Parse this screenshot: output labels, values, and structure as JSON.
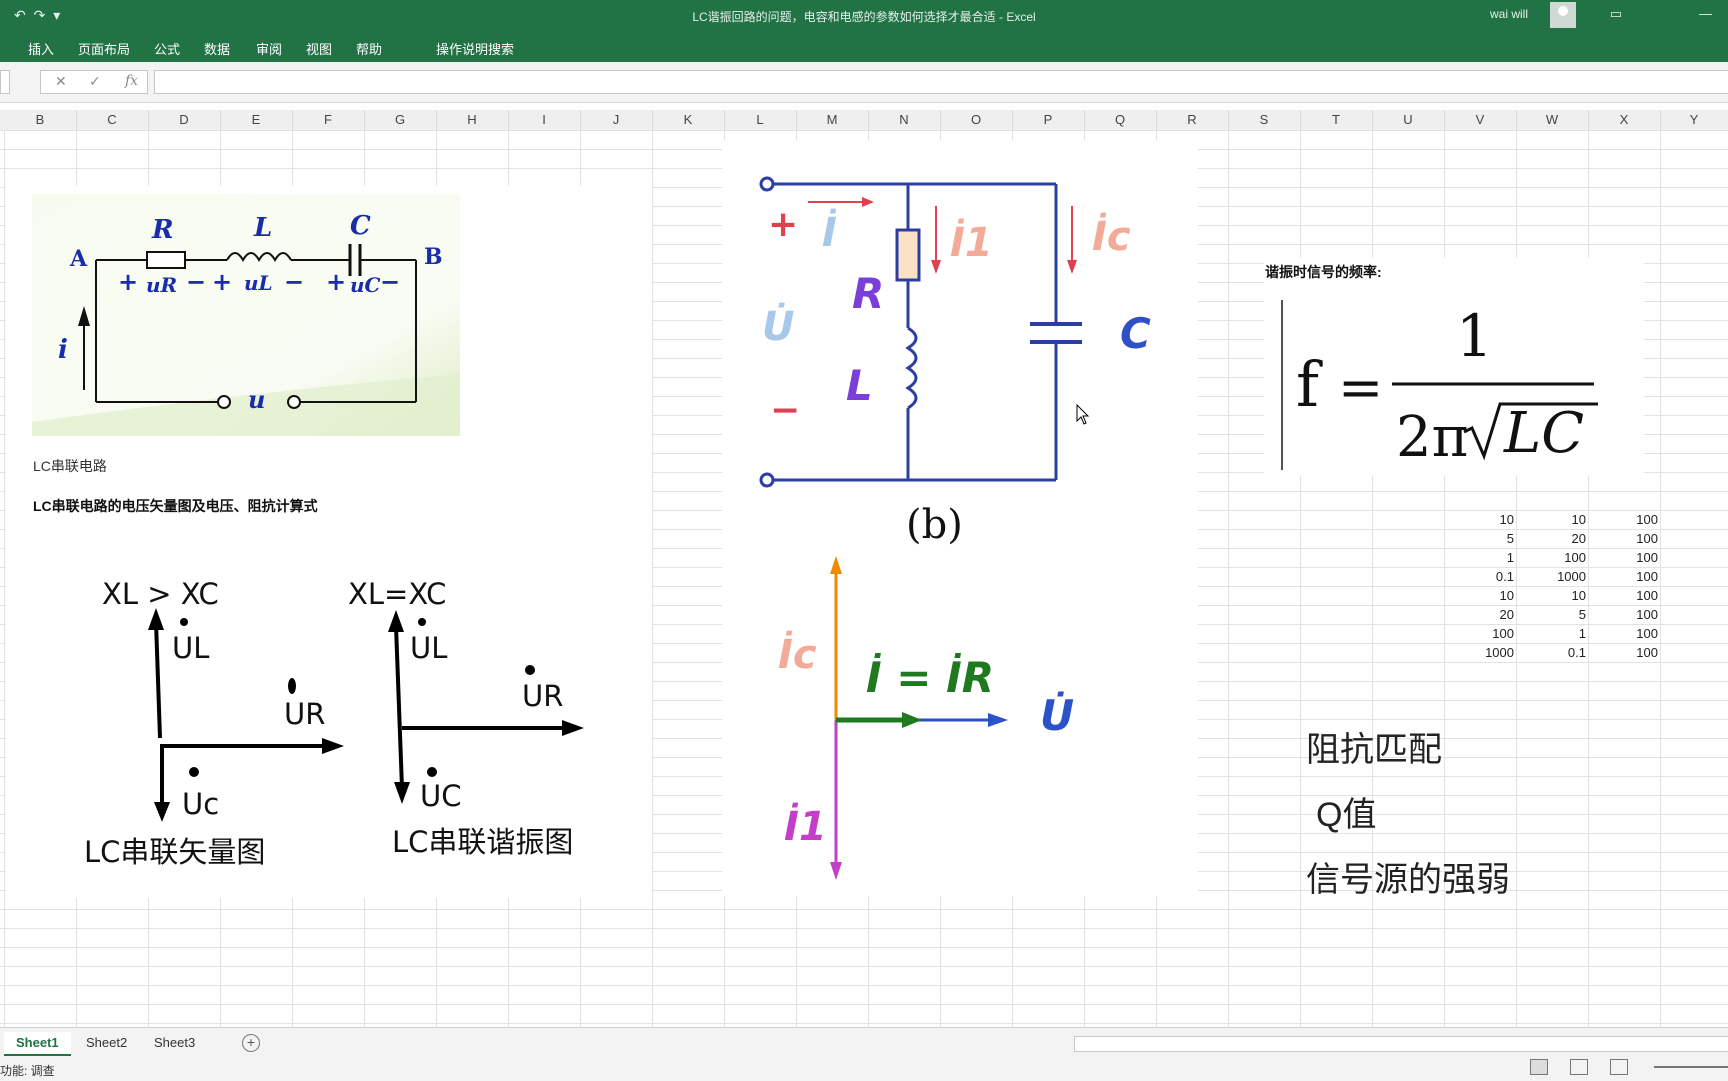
{
  "window": {
    "title": "LC谐振回路的问题，电容和电感的参数如何选择才最合适  -  Excel",
    "user": "wai will",
    "qat": "↶ ↷ ▾"
  },
  "ribbon": {
    "tabs": [
      "插入",
      "页面布局",
      "公式",
      "数据",
      "审阅",
      "视图",
      "帮助"
    ],
    "search": "操作说明搜索"
  },
  "formula_bar": {
    "cancel_icon": "✕",
    "enter_icon": "✓",
    "fx_label": "fx",
    "value": ""
  },
  "columns": [
    "B",
    "C",
    "D",
    "E",
    "F",
    "G",
    "H",
    "I",
    "J",
    "K",
    "L",
    "M",
    "N",
    "O",
    "P",
    "Q",
    "R",
    "S",
    "T",
    "U",
    "V",
    "W",
    "X",
    "Y"
  ],
  "series_circuit": {
    "labels": {
      "R": "R",
      "L": "L",
      "C": "C",
      "A": "A",
      "B": "B",
      "i": "i",
      "u": "u",
      "uR": "uR",
      "uL": "uL",
      "uC": "uC"
    },
    "caption": "LC串联电路"
  },
  "heading_vector": "LC串联电路的电压矢量图及电压、阻抗计算式",
  "vector_left": {
    "condition": "XL > XC",
    "UL": "UL",
    "UR": "UR",
    "UC": "Uc",
    "caption": "LC串联矢量图"
  },
  "vector_right": {
    "condition": "XL=XC",
    "UL": "UL",
    "UR": "UR",
    "UC": "UC",
    "caption": "LC串联谐振图"
  },
  "parallel_circuit": {
    "plus": "+",
    "minus": "−",
    "I": "İ",
    "U": "U̇",
    "I1": "İ1",
    "Ic": "İc",
    "R": "R",
    "L": "L",
    "C": "C",
    "caption": "(b)"
  },
  "phasor_parallel": {
    "Ic": "İc",
    "I_eq_IR": "İ = İR",
    "U": "U̇",
    "I1": "İ1"
  },
  "frequency": {
    "heading": "谐振时信号的频率:",
    "lhs": "f",
    "eq": "=",
    "numerator": "1",
    "denominator_prefix": "2π",
    "denominator_radicand": "LC"
  },
  "value_table": [
    [
      "10",
      "10",
      "100"
    ],
    [
      "5",
      "20",
      "100"
    ],
    [
      "1",
      "100",
      "100"
    ],
    [
      "0.1",
      "1000",
      "100"
    ],
    [
      "10",
      "10",
      "100"
    ],
    [
      "20",
      "5",
      "100"
    ],
    [
      "100",
      "1",
      "100"
    ],
    [
      "1000",
      "0.1",
      "100"
    ]
  ],
  "notes": [
    "阻抗匹配",
    "Q值",
    "信号源的强弱"
  ],
  "sheets": [
    "Sheet1",
    "Sheet2",
    "Sheet3"
  ],
  "add_sheet_icon": "+",
  "status": "功能: 调查"
}
